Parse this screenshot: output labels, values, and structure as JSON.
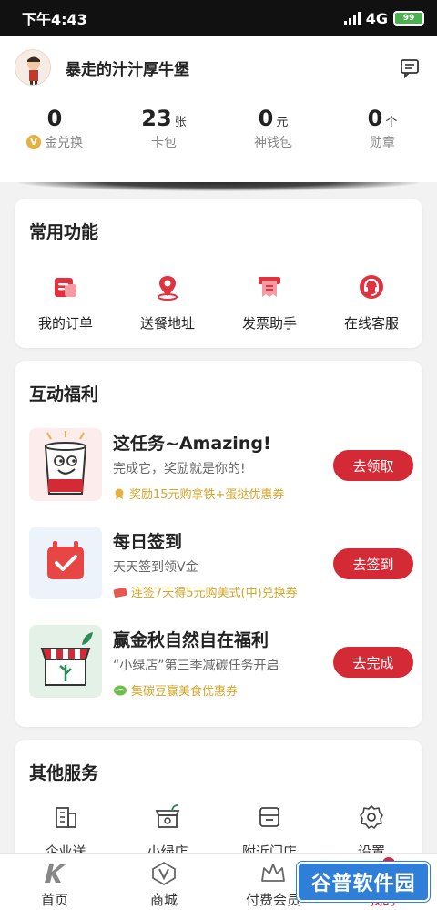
{
  "status_bar": {
    "time": "下午4:43",
    "network": "4G",
    "battery": "99"
  },
  "profile": {
    "username": "暴走的汁汁厚牛堡",
    "stats": [
      {
        "value": "0",
        "unit": "",
        "label": "金兑换",
        "coin_icon": "V"
      },
      {
        "value": "23",
        "unit": "张",
        "label": "卡包"
      },
      {
        "value": "0",
        "unit": "元",
        "label": "神钱包"
      },
      {
        "value": "0",
        "unit": "个",
        "label": "勋章"
      }
    ]
  },
  "common_functions": {
    "title": "常用功能",
    "items": [
      {
        "label": "我的订单",
        "icon": "order-icon"
      },
      {
        "label": "送餐地址",
        "icon": "location-pin-icon"
      },
      {
        "label": "发票助手",
        "icon": "invoice-icon"
      },
      {
        "label": "在线客服",
        "icon": "headset-icon"
      }
    ]
  },
  "interactive_benefits": {
    "title": "互动福利",
    "tasks": [
      {
        "title": "这任务~Amazing!",
        "desc": "完成它，奖励就是你的!",
        "reward": "奖励15元购拿铁+蛋挞优惠券",
        "button": "去领取"
      },
      {
        "title": "每日签到",
        "desc": "天天签到领V金",
        "reward": "连签7天得5元购美式(中)兑换券",
        "button": "去签到"
      },
      {
        "title": "赢金秋自然自在福利",
        "desc": "“小绿店”第三季减碳任务开启",
        "reward": "集碳豆赢美食优惠券",
        "button": "去完成"
      }
    ]
  },
  "other_services": {
    "title": "其他服务",
    "items": [
      {
        "label": "企业送",
        "icon": "building-icon"
      },
      {
        "label": "小绿店",
        "icon": "green-store-icon"
      },
      {
        "label": "附近门店",
        "icon": "store-icon"
      },
      {
        "label": "设置",
        "icon": "gear-icon"
      }
    ]
  },
  "bottom_nav": {
    "items": [
      {
        "label": "首页",
        "icon": "kfc-k-icon"
      },
      {
        "label": "商城",
        "icon": "v-shop-icon"
      },
      {
        "label": "付费会员",
        "icon": "crown-icon"
      },
      {
        "label": "我的",
        "icon": "user-icon"
      }
    ]
  },
  "watermark": "谷普软件园",
  "colors": {
    "accent": "#d42a35",
    "reward": "#d4a52a"
  }
}
